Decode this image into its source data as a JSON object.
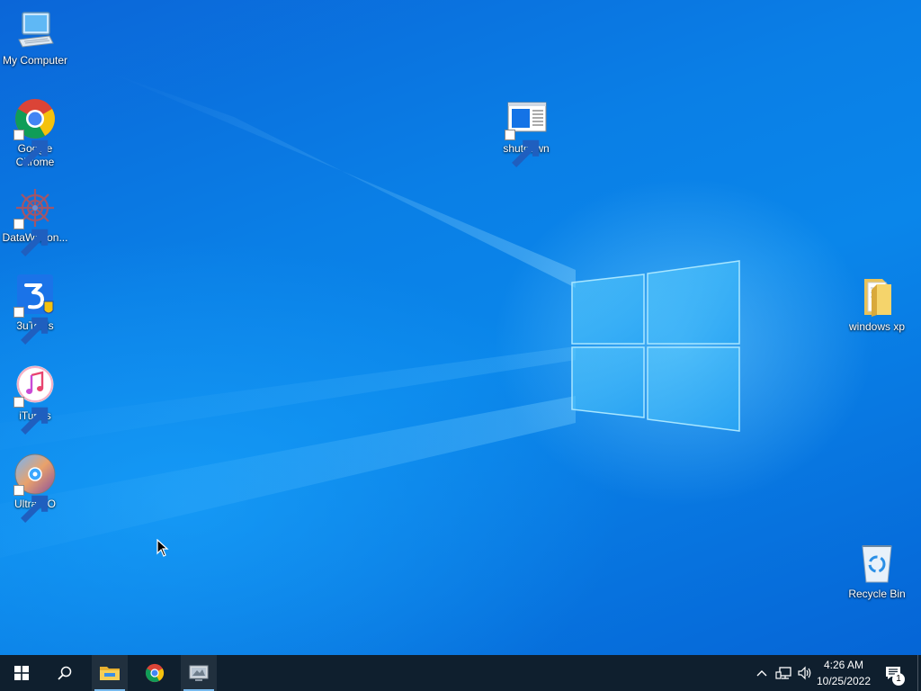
{
  "desktop": {
    "icons": [
      {
        "label": "My Computer",
        "icon": "computer-icon"
      },
      {
        "label": "Google Chrome",
        "icon": "chrome-icon"
      },
      {
        "label": "DataWagon...",
        "icon": "datawagon-icon"
      },
      {
        "label": "3uTools",
        "icon": "3utools-icon"
      },
      {
        "label": "iTunes",
        "icon": "itunes-icon"
      },
      {
        "label": "UltraISO",
        "icon": "ultraiso-icon"
      },
      {
        "label": "shutdown",
        "icon": "shutdown-shortcut-icon"
      },
      {
        "label": "windows xp",
        "icon": "folder-icon"
      },
      {
        "label": "Recycle Bin",
        "icon": "recycle-bin-icon"
      }
    ]
  },
  "taskbar": {
    "start": "start-icon",
    "search": "search-icon",
    "apps": [
      {
        "name": "File Explorer",
        "icon": "file-explorer-icon",
        "active": true
      },
      {
        "name": "Google Chrome",
        "icon": "chrome-icon",
        "active": false
      },
      {
        "name": "Remote Desktop",
        "icon": "remote-app-icon",
        "active": true
      }
    ],
    "tray": {
      "time": "4:26 AM",
      "date": "10/25/2022",
      "notification_count": "1"
    }
  },
  "colors": {
    "taskbar": "#0f1f2e",
    "accent": "#76b9ed",
    "desktop": "#0a7fe6"
  }
}
